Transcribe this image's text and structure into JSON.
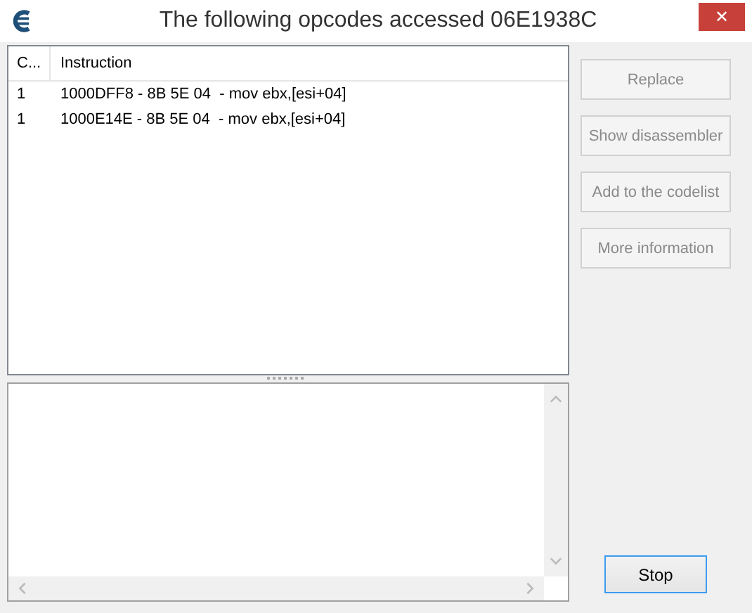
{
  "window": {
    "title": "The following opcodes accessed 06E1938C",
    "close": "✕"
  },
  "table": {
    "columns": [
      "C...",
      "Instruction"
    ],
    "rows": [
      {
        "count": "1",
        "instruction": "1000DFF8 - 8B 5E 04  - mov ebx,[esi+04]"
      },
      {
        "count": "1",
        "instruction": "1000E14E - 8B 5E 04  - mov ebx,[esi+04]"
      }
    ]
  },
  "buttons": [
    {
      "label": "Replace",
      "disabled": true
    },
    {
      "label": "Show disassembler",
      "disabled": true
    },
    {
      "label": "Add to the codelist",
      "disabled": true
    },
    {
      "label": "More information",
      "disabled": true
    }
  ],
  "stop_button": {
    "label": "Stop",
    "disabled": false
  }
}
